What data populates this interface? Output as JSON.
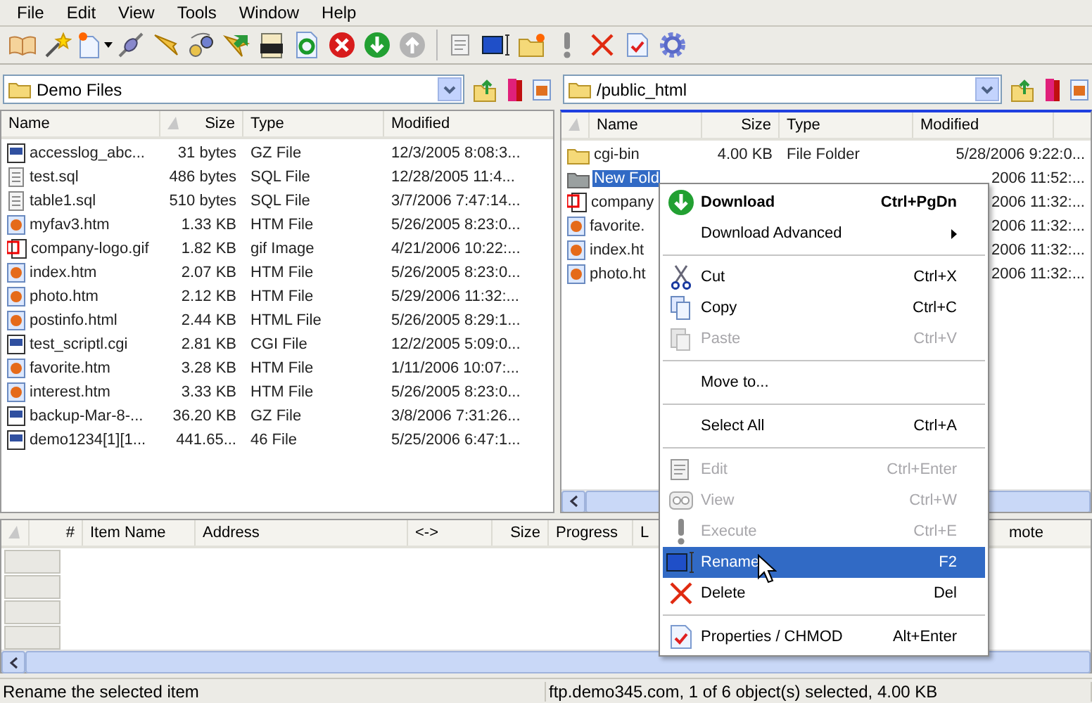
{
  "menu_bar": [
    "File",
    "Edit",
    "View",
    "Tools",
    "Window",
    "Help"
  ],
  "local_pane": {
    "path": "Demo Files",
    "columns": [
      "Name",
      "Size",
      "Type",
      "Modified"
    ],
    "rows": [
      {
        "kind": "archive",
        "name": "accesslog_abc...",
        "size": "31 bytes",
        "type": "GZ File",
        "modified": "12/3/2005 8:08:3...",
        "selected": false
      },
      {
        "kind": "text",
        "name": "test.sql",
        "size": "486 bytes",
        "type": "SQL File",
        "modified": "12/28/2005 11:4...",
        "selected": false
      },
      {
        "kind": "text",
        "name": "table1.sql",
        "size": "510 bytes",
        "type": "SQL File",
        "modified": "3/7/2006 7:47:14...",
        "selected": false
      },
      {
        "kind": "web",
        "name": "myfav3.htm",
        "size": "1.33 KB",
        "type": "HTM File",
        "modified": "5/26/2005 8:23:0...",
        "selected": false
      },
      {
        "kind": "image",
        "name": "company-logo.gif",
        "size": "1.82 KB",
        "type": "gif Image",
        "modified": "4/21/2006 10:22:...",
        "selected": false
      },
      {
        "kind": "web",
        "name": "index.htm",
        "size": "2.07 KB",
        "type": "HTM File",
        "modified": "5/26/2005 8:23:0...",
        "selected": false
      },
      {
        "kind": "web",
        "name": "photo.htm",
        "size": "2.12 KB",
        "type": "HTM File",
        "modified": "5/29/2006 11:32:...",
        "selected": false
      },
      {
        "kind": "web",
        "name": "postinfo.html",
        "size": "2.44 KB",
        "type": "HTML File",
        "modified": "5/26/2005 8:29:1...",
        "selected": false
      },
      {
        "kind": "archive",
        "name": "test_scriptl.cgi",
        "size": "2.81 KB",
        "type": "CGI File",
        "modified": "12/2/2005 5:09:0...",
        "selected": false
      },
      {
        "kind": "web",
        "name": "favorite.htm",
        "size": "3.28 KB",
        "type": "HTM File",
        "modified": "1/11/2006 10:07:...",
        "selected": false
      },
      {
        "kind": "web",
        "name": "interest.htm",
        "size": "3.33 KB",
        "type": "HTM File",
        "modified": "5/26/2005 8:23:0...",
        "selected": false
      },
      {
        "kind": "archive",
        "name": "backup-Mar-8-...",
        "size": "36.20 KB",
        "type": "GZ File",
        "modified": "3/8/2006 7:31:26...",
        "selected": false
      },
      {
        "kind": "archive",
        "name": "demo1234[1][1...",
        "size": "441.65...",
        "type": "46 File",
        "modified": "5/25/2006 6:47:1...",
        "selected": false
      }
    ]
  },
  "remote_pane": {
    "path": "/public_html",
    "columns": [
      "Name",
      "Size",
      "Type",
      "Modified"
    ],
    "rows": [
      {
        "kind": "folder",
        "name": "cgi-bin",
        "size": "4.00 KB",
        "type": "File Folder",
        "modified": "5/28/2006 9:22:0...",
        "selected": false
      },
      {
        "kind": "folder",
        "name": "New Fold",
        "modified": "2006 11:52:...",
        "selected": true
      },
      {
        "kind": "image",
        "name": "company",
        "modified": "2006 11:32:...",
        "selected": false
      },
      {
        "kind": "web",
        "name": "favorite.",
        "modified": "2006 11:32:...",
        "selected": false
      },
      {
        "kind": "web",
        "name": "index.ht",
        "modified": "2006 11:32:...",
        "selected": false
      },
      {
        "kind": "web",
        "name": "photo.ht",
        "modified": "2006 11:32:...",
        "selected": false
      }
    ]
  },
  "queue": {
    "columns": [
      "#",
      "Item Name",
      "Address",
      "<->",
      "Size",
      "Progress",
      "L",
      "mote"
    ]
  },
  "context_menu": [
    {
      "kind": "item",
      "label": "Download",
      "shortcut": "Ctrl+PgDn",
      "default": true,
      "disabled": false,
      "selected": false
    },
    {
      "kind": "item",
      "label": "Download Advanced",
      "submenu": true,
      "disabled": false,
      "selected": false
    },
    {
      "kind": "separator"
    },
    {
      "kind": "item",
      "label": "Cut",
      "shortcut": "Ctrl+X",
      "disabled": false,
      "selected": false
    },
    {
      "kind": "item",
      "label": "Copy",
      "shortcut": "Ctrl+C",
      "disabled": false,
      "selected": false
    },
    {
      "kind": "item",
      "label": "Paste",
      "shortcut": "Ctrl+V",
      "disabled": true,
      "selected": false
    },
    {
      "kind": "separator"
    },
    {
      "kind": "item",
      "label": "Move to...",
      "disabled": false,
      "selected": false
    },
    {
      "kind": "separator"
    },
    {
      "kind": "item",
      "label": "Select All",
      "shortcut": "Ctrl+A",
      "disabled": false,
      "selected": false
    },
    {
      "kind": "separator"
    },
    {
      "kind": "item",
      "label": "Edit",
      "shortcut": "Ctrl+Enter",
      "disabled": true,
      "selected": false
    },
    {
      "kind": "item",
      "label": "View",
      "shortcut": "Ctrl+W",
      "disabled": true,
      "selected": false
    },
    {
      "kind": "item",
      "label": "Execute",
      "shortcut": "Ctrl+E",
      "disabled": true,
      "selected": false
    },
    {
      "kind": "item",
      "label": "Rename",
      "shortcut": "F2",
      "disabled": false,
      "selected": true
    },
    {
      "kind": "item",
      "label": "Delete",
      "shortcut": "Del",
      "disabled": false,
      "selected": false
    },
    {
      "kind": "separator"
    },
    {
      "kind": "item",
      "label": "Properties / CHMOD",
      "shortcut": "Alt+Enter",
      "disabled": false,
      "selected": false
    }
  ],
  "status_bar": [
    "Rename the selected item",
    "ftp.demo345.com, 1 of 6 object(s) selected, 4.00 KB"
  ]
}
